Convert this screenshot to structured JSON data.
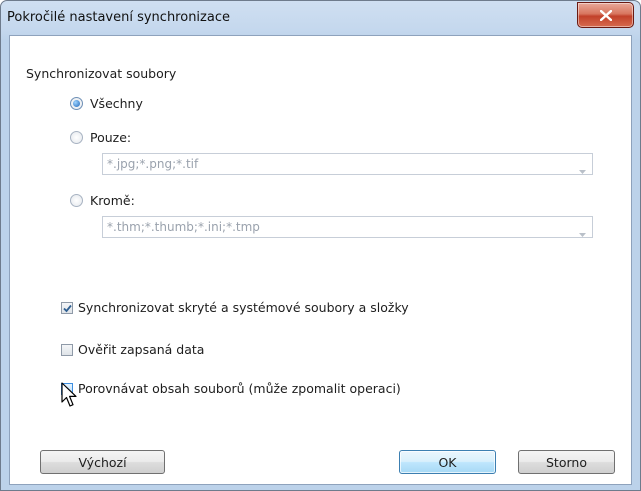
{
  "window": {
    "title": "Pokročilé nastavení synchronizace"
  },
  "sync_files": {
    "group_label": "Synchronizovat soubory",
    "options": [
      {
        "label": "Všechny",
        "selected": true
      },
      {
        "label": "Pouze:",
        "selected": false,
        "combo_value": "*.jpg;*.png;*.tif"
      },
      {
        "label": "Kromě:",
        "selected": false,
        "combo_value": "*.thm;*.thumb;*.ini;*.tmp"
      }
    ]
  },
  "checkboxes": [
    {
      "label": "Synchronizovat skryté a systémové soubory a složky",
      "checked": true
    },
    {
      "label": "Ověřit zapsaná data",
      "checked": false
    },
    {
      "label": "Porovnávat obsah souborů (může zpomalit operaci)",
      "checked": false
    }
  ],
  "buttons": {
    "defaults": "Výchozí",
    "ok": "OK",
    "cancel": "Storno"
  },
  "colors": {
    "accent": "#3c7fb1",
    "close": "#c2412a"
  }
}
